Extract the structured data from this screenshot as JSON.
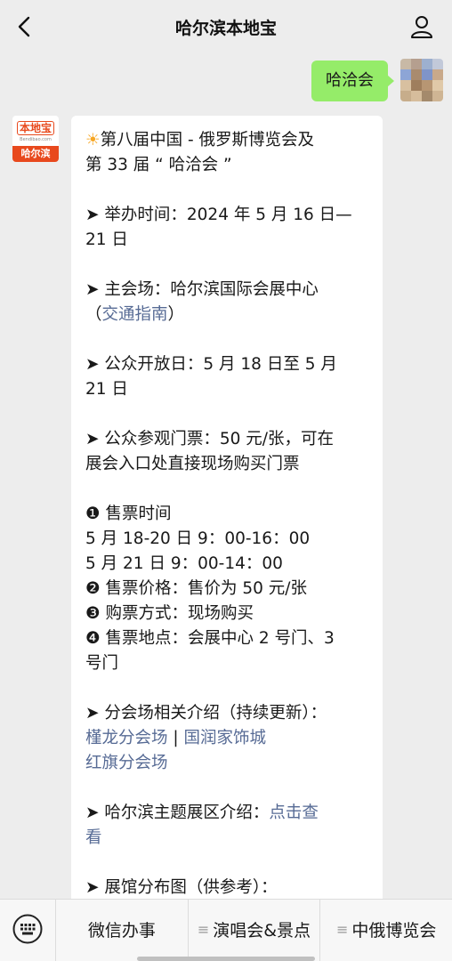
{
  "header": {
    "title": "哈尔滨本地宝"
  },
  "outgoing": {
    "text": "哈洽会"
  },
  "bot": {
    "logo_main": "本地宝",
    "logo_sub": "Bendibao.com",
    "logo_city": "哈尔滨"
  },
  "message": {
    "line1": "第八届中国 - 俄罗斯博览会及",
    "line2": "第 33 届 “ 哈洽会 ”",
    "time1": "➤ 举办时间：2024 年 5 月 16 日—",
    "time2": "21 日",
    "venue1": "➤ 主会场：哈尔滨国际会展中心",
    "venue_open": "（",
    "venue_link": "交通指南",
    "venue_close": "）",
    "open1": "➤ 公众开放日：5 月 18 日至 5 月",
    "open2": "21 日",
    "ticket1": "➤ 公众参观门票：50 元/张，可在",
    "ticket2": "展会入口处直接现场购买门票",
    "sale_time_label": "❶ 售票时间",
    "sale_time_1": "5 月 18-20 日 9：00-16：00",
    "sale_time_2": "5 月 21 日 9：00-14：00",
    "sale_price": "❷ 售票价格：售价为 50 元/张",
    "sale_method": "❸ 购票方式：现场购买",
    "sale_place1": "❹ 售票地点：会展中心 2 号门、3",
    "sale_place2": "号门",
    "branch_title": "➤ 分会场相关介绍（持续更新）：",
    "branch_link1": "槿龙分会场",
    "branch_sep": " | ",
    "branch_link2": "国润家饰城",
    "branch_link3": "红旗分会场",
    "theme_prefix": "➤ 哈尔滨主题展区介绍：",
    "theme_link1": "点击查",
    "theme_link2": "看",
    "map_title": "➤ 展馆分布图（供参考）："
  },
  "bottom_menu": [
    {
      "label": "微信办事"
    },
    {
      "label": "演唱会&景点"
    },
    {
      "label": "中俄博览会"
    }
  ],
  "colors": {
    "out_bubble": "#95ec69",
    "link": "#576b95",
    "brand": "#e8491d"
  }
}
